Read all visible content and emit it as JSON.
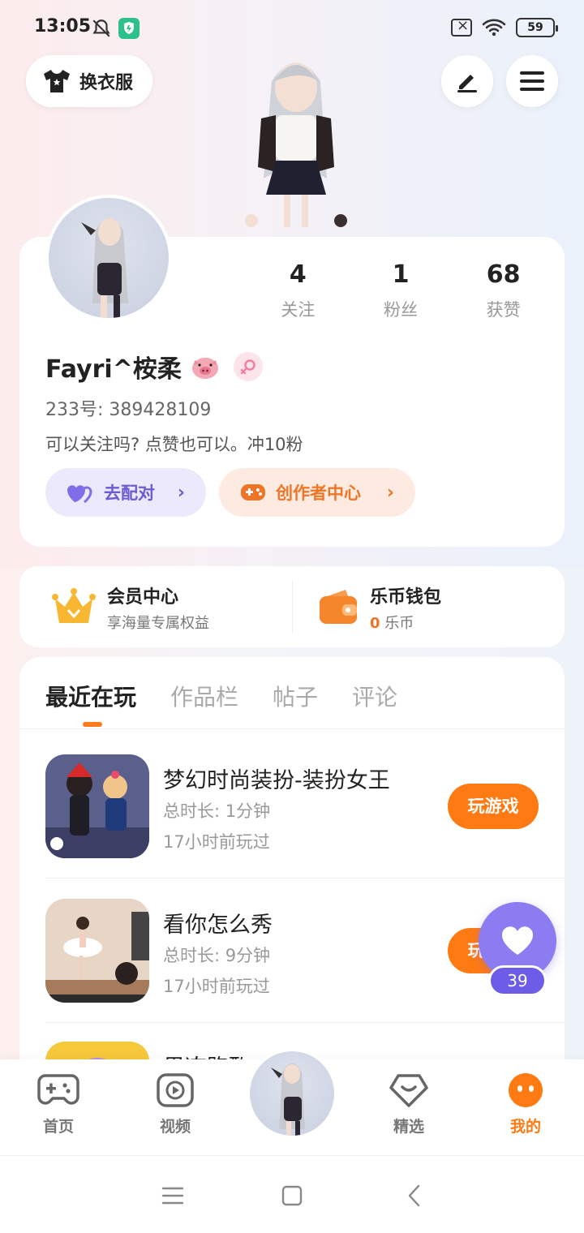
{
  "status_bar": {
    "time": "13:05",
    "battery": "59"
  },
  "top": {
    "outfit_label": "换衣服"
  },
  "profile": {
    "stats": [
      {
        "value": "4",
        "label": "关注"
      },
      {
        "value": "1",
        "label": "粉丝"
      },
      {
        "value": "68",
        "label": "获赞"
      }
    ],
    "username": "Fayri^桉柔",
    "uid": "233号: 389428109",
    "bio": "可以关注吗? 点赞也可以。冲10粉",
    "match_label": "去配对",
    "creator_label": "创作者中心"
  },
  "member": {
    "vip_title": "会员中心",
    "vip_sub": "享海量专属权益",
    "wallet_title": "乐币钱包",
    "wallet_amount": "0",
    "wallet_unit": "乐币"
  },
  "tabs": [
    "最近在玩",
    "作品栏",
    "帖子",
    "评论"
  ],
  "games": [
    {
      "title": "梦幻时尚装扮-装扮女王",
      "duration": "总时长: 1分钟",
      "last_played": "17小时前玩过",
      "action": "玩游戏"
    },
    {
      "title": "看你怎么秀",
      "duration": "总时长: 9分钟",
      "last_played": "17小时前玩过",
      "action": "玩游戏"
    },
    {
      "title": "果冻跑酷"
    }
  ],
  "like_float": {
    "count": "39"
  },
  "nav": {
    "home": "首页",
    "video": "视频",
    "featured": "精选",
    "mine": "我的"
  },
  "colors": {
    "accent": "#ff7a12",
    "purple": "#8c7cf2",
    "creator": "#ef7425"
  }
}
